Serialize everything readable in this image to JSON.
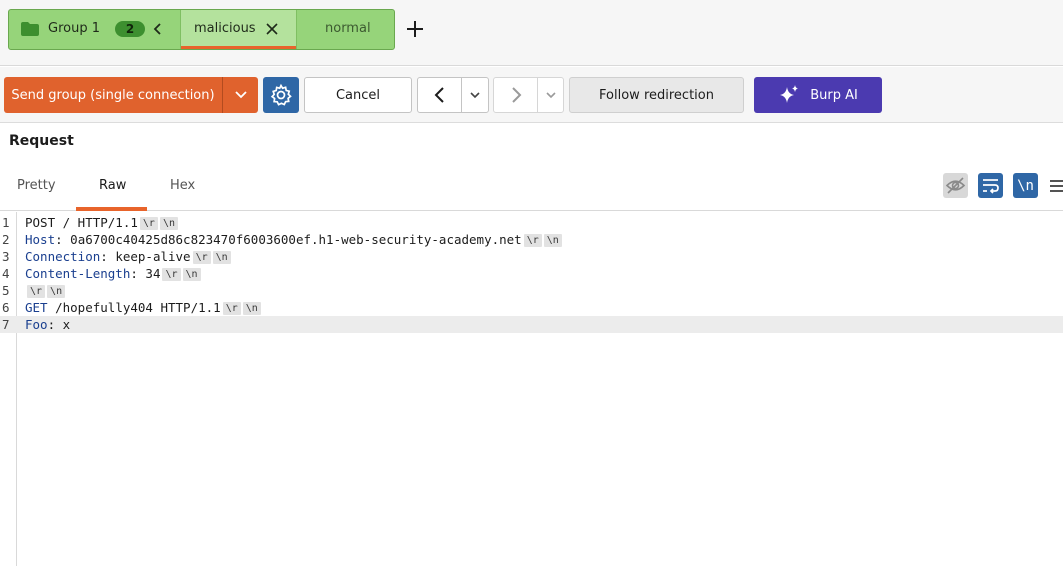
{
  "tab_group": {
    "name": "Group 1",
    "count": "2",
    "tabs": [
      {
        "label": "malicious",
        "active": true
      },
      {
        "label": "normal",
        "active": false
      }
    ]
  },
  "toolbar": {
    "send_label": "Send group (single connection)",
    "cancel_label": "Cancel",
    "follow_label": "Follow redirection",
    "ai_label": "Burp AI"
  },
  "request": {
    "title": "Request",
    "view_tabs": [
      "Pretty",
      "Raw",
      "Hex"
    ],
    "active_view": "Raw",
    "newline_toggle_label": "\\n",
    "escapes": {
      "cr": "\\r",
      "lf": "\\n"
    },
    "lines": [
      {
        "num": "1",
        "name": "",
        "sep": "",
        "value": "POST / HTTP/1.1",
        "crlf": true
      },
      {
        "num": "2",
        "name": "Host",
        "sep": ": ",
        "value": "0a6700c40425d86c823470f6003600ef.h1-web-security-academy.net",
        "crlf": true
      },
      {
        "num": "3",
        "name": "Connection",
        "sep": ": ",
        "value": "keep-alive",
        "crlf": true
      },
      {
        "num": "4",
        "name": "Content-Length",
        "sep": ": ",
        "value": "34",
        "crlf": true
      },
      {
        "num": "5",
        "name": "",
        "sep": "",
        "value": "",
        "crlf": true
      },
      {
        "num": "6",
        "name": "GET",
        "sep": " ",
        "value": "/hopefully404 HTTP/1.1",
        "crlf": true
      },
      {
        "num": "7",
        "name": "Foo",
        "sep": ": ",
        "value": "x",
        "crlf": false
      }
    ]
  },
  "colors": {
    "accent": "#e0622d",
    "group_green": "#96d47a",
    "ai_purple": "#4b3ab0",
    "header_blue": "#1a3f8f"
  }
}
